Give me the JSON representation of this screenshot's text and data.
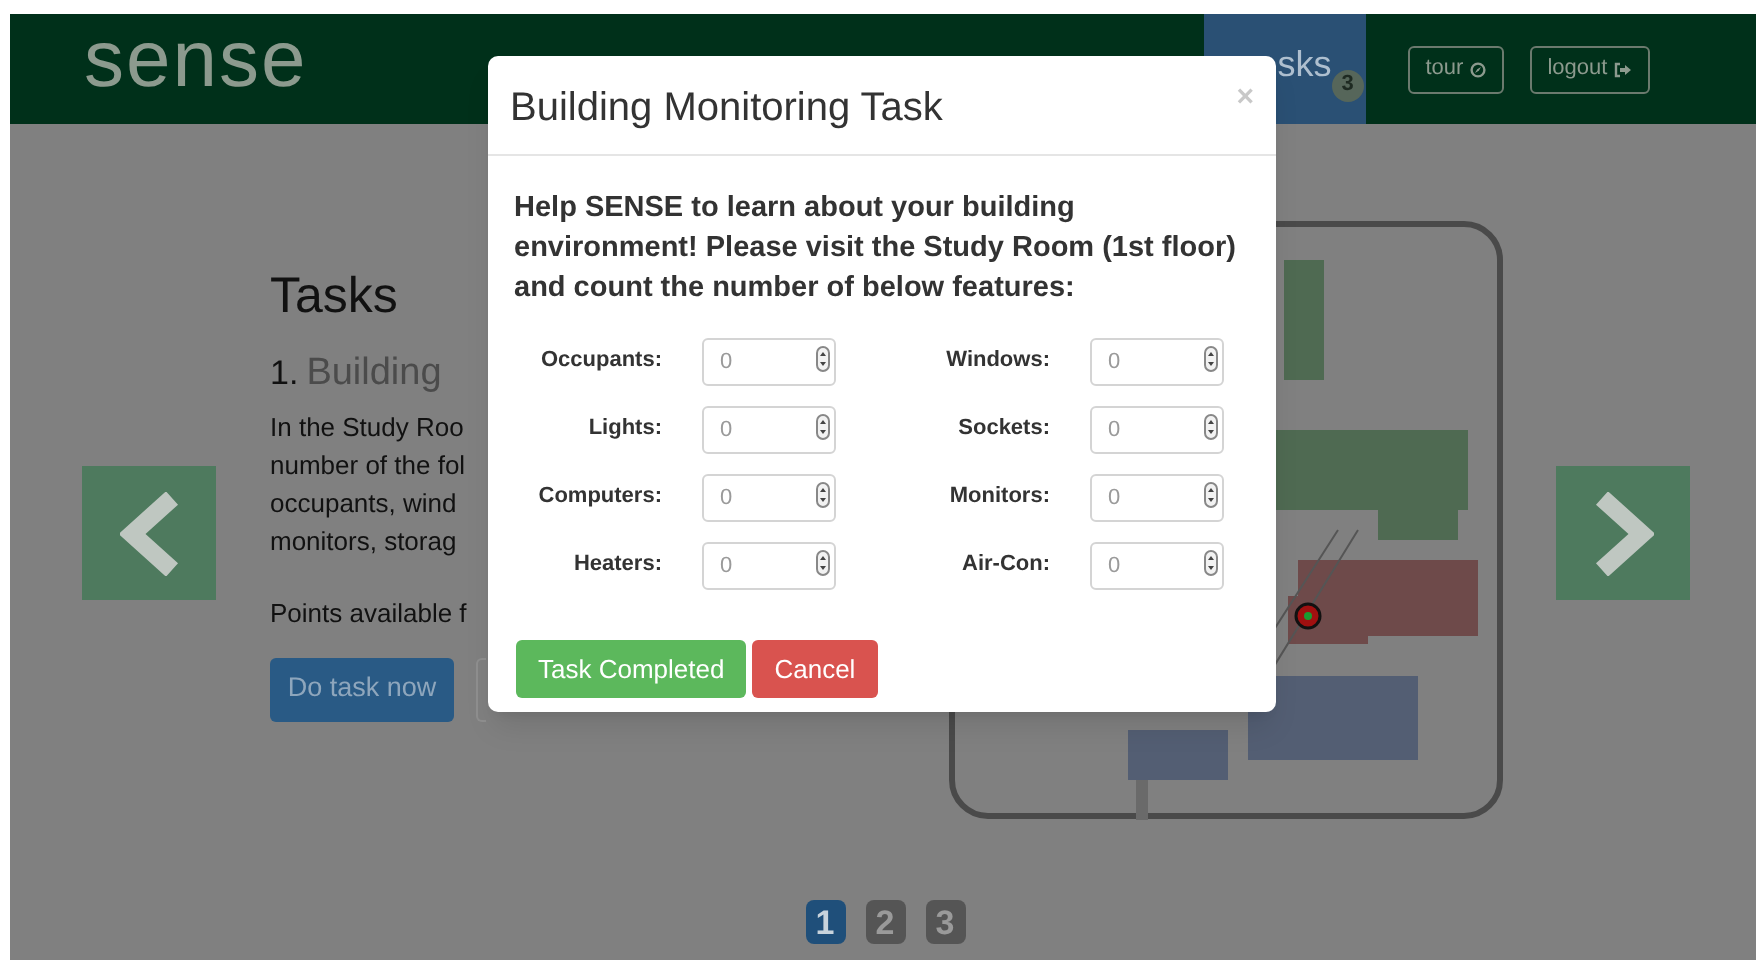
{
  "navbar": {
    "brand": "sense",
    "tabs": [
      {
        "label": "sks",
        "badge": "3",
        "selected": true
      }
    ],
    "buttons": [
      {
        "label": "tour",
        "kind": "compass"
      },
      {
        "label": "logout",
        "kind": "exit"
      }
    ]
  },
  "page": {
    "heading": "Tasks",
    "task": {
      "number": "1.",
      "title": "Building",
      "description_lines": [
        "In the Study Roo",
        "number of the fol",
        "occupants, wind",
        "monitors, storag"
      ],
      "points": "Points available f",
      "button": "Do task now"
    },
    "pagination": [
      {
        "label": "1",
        "selected": true
      },
      {
        "label": "2",
        "selected": false
      },
      {
        "label": "3",
        "selected": false
      }
    ]
  },
  "modal": {
    "title": "Building Monitoring Task",
    "close": "×",
    "prompt_lines": [
      "Help SENSE to learn about your building",
      "environment! Please visit the Study Room (1st floor)",
      "and count the number of below features:"
    ],
    "fields": [
      {
        "label": "Occupants:",
        "placeholder": "0"
      },
      {
        "label": "Windows:",
        "placeholder": "0"
      },
      {
        "label": "Lights:",
        "placeholder": "0"
      },
      {
        "label": "Sockets:",
        "placeholder": "0"
      },
      {
        "label": "Computers:",
        "placeholder": "0"
      },
      {
        "label": "Monitors:",
        "placeholder": "0"
      },
      {
        "label": "Heaters:",
        "placeholder": "0"
      },
      {
        "label": "Air-Con:",
        "placeholder": "0"
      }
    ],
    "buttons": [
      {
        "label": "Task Completed",
        "kind": "success"
      },
      {
        "label": "Cancel",
        "kind": "danger"
      }
    ]
  }
}
